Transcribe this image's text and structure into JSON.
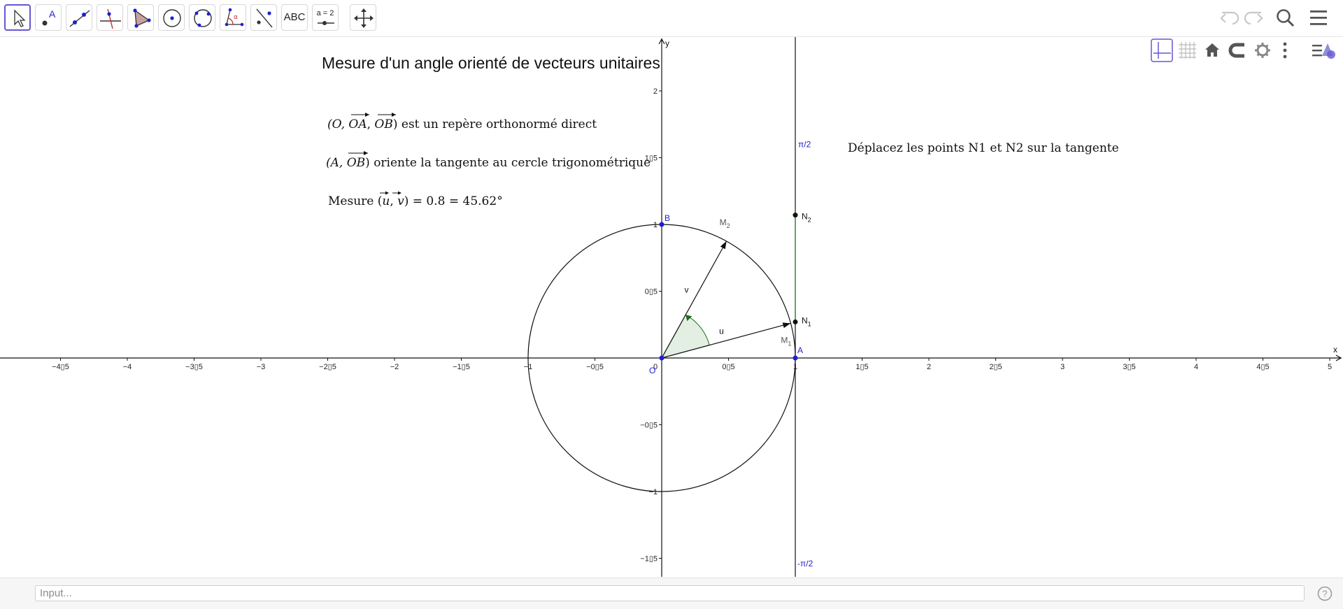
{
  "toolbar": {
    "tools": [
      {
        "name": "move",
        "icon": "move-arrow-icon",
        "active": true
      },
      {
        "name": "point",
        "icon": "point-icon",
        "label": "A"
      },
      {
        "name": "line",
        "icon": "line-through-two-points-icon"
      },
      {
        "name": "perpendicular-line",
        "icon": "perpendicular-line-icon"
      },
      {
        "name": "polygon",
        "icon": "polygon-icon"
      },
      {
        "name": "circle",
        "icon": "circle-center-point-icon"
      },
      {
        "name": "circle-three-points",
        "icon": "circle-three-points-icon"
      },
      {
        "name": "angle",
        "icon": "angle-icon"
      },
      {
        "name": "reflect",
        "icon": "reflect-about-line-icon"
      },
      {
        "name": "text",
        "icon": "text-icon",
        "label": "ABC"
      },
      {
        "name": "slider",
        "icon": "slider-icon",
        "label": "a = 2"
      },
      {
        "name": "move-graphics-view",
        "icon": "move-graphics-view-icon"
      }
    ],
    "right_icons": [
      "undo-icon",
      "redo-icon",
      "search-icon",
      "menu-icon"
    ]
  },
  "style_bar": {
    "buttons": [
      "axes-toggle-icon",
      "grid-toggle-icon",
      "home-icon",
      "magnet-snap-icon",
      "settings-gear-icon",
      "more-vertical-icon",
      "style-bar-toggle-icon"
    ]
  },
  "graphics": {
    "title": "Mesure d'un angle orienté de vecteurs unitaires",
    "text1_prefix": "(O, ",
    "text1_vec1": "OA",
    "text1_sep": ", ",
    "text1_vec2": "OB",
    "text1_suffix": ") est un repère orthonormé direct",
    "text2_prefix": "(A, ",
    "text2_vec": "OB",
    "text2_suffix": ") oriente la tangente au cercle trigonométrique",
    "text3_prefix": "Mesure (",
    "text3_vec1": "u",
    "text3_sep": ", ",
    "text3_vec2": "v",
    "text3_suffix": ") = 0.8 = 45.62°",
    "instruction": "Déplacez les points N1 et N2 sur la tangente",
    "axis_x_label": "x",
    "axis_y_label": "y",
    "x_ticks": [
      "−4▯5",
      "−4",
      "−3▯5",
      "−3",
      "−2▯5",
      "−2",
      "−1▯5",
      "−1",
      "−0▯5",
      "0",
      "0▯5",
      "1",
      "1▯5",
      "2",
      "2▯5",
      "3",
      "3▯5",
      "4",
      "4▯5",
      "5"
    ],
    "x_tick_values": [
      -4.5,
      -4,
      -3.5,
      -3,
      -2.5,
      -2,
      -1.5,
      -1,
      -0.5,
      0,
      0.5,
      1,
      1.5,
      2,
      2.5,
      3,
      3.5,
      4,
      4.5,
      5
    ],
    "y_ticks": [
      "2",
      "1▯5",
      "1",
      "0▯5",
      "−0▯5",
      "−1",
      "−1▯5"
    ],
    "y_tick_values": [
      2,
      1.5,
      1,
      0.5,
      -0.5,
      -1,
      -1.5
    ],
    "tangent_top_label": "π/2",
    "tangent_bottom_label": "-π/2",
    "points": {
      "O": {
        "label": "O",
        "x": 0,
        "y": 0
      },
      "A": {
        "label": "A",
        "x": 1,
        "y": 0
      },
      "B": {
        "label": "B",
        "x": 0,
        "y": 1
      },
      "N1": {
        "label": "N",
        "sub": "1",
        "x": 1,
        "y": 0.27
      },
      "N2": {
        "label": "N",
        "sub": "2",
        "x": 1,
        "y": 1.07
      },
      "M1": {
        "label": "M",
        "sub": "1",
        "x": 0.965,
        "y": 0.26
      },
      "M2": {
        "label": "M",
        "sub": "2",
        "x": 0.485,
        "y": 0.875
      }
    },
    "vector_u_label": "u",
    "vector_v_label": "v",
    "colors": {
      "points_blue": "#1f1fd0",
      "tangent_label_blue": "#1f1fd0",
      "segment_green": "#2a8a2a",
      "angle_fill": "#e3efe3",
      "angle_stroke": "#1e6b1e",
      "accent_purple": "#6557d2"
    }
  },
  "input_bar": {
    "placeholder": "Input...",
    "help_icon": "help-icon"
  }
}
